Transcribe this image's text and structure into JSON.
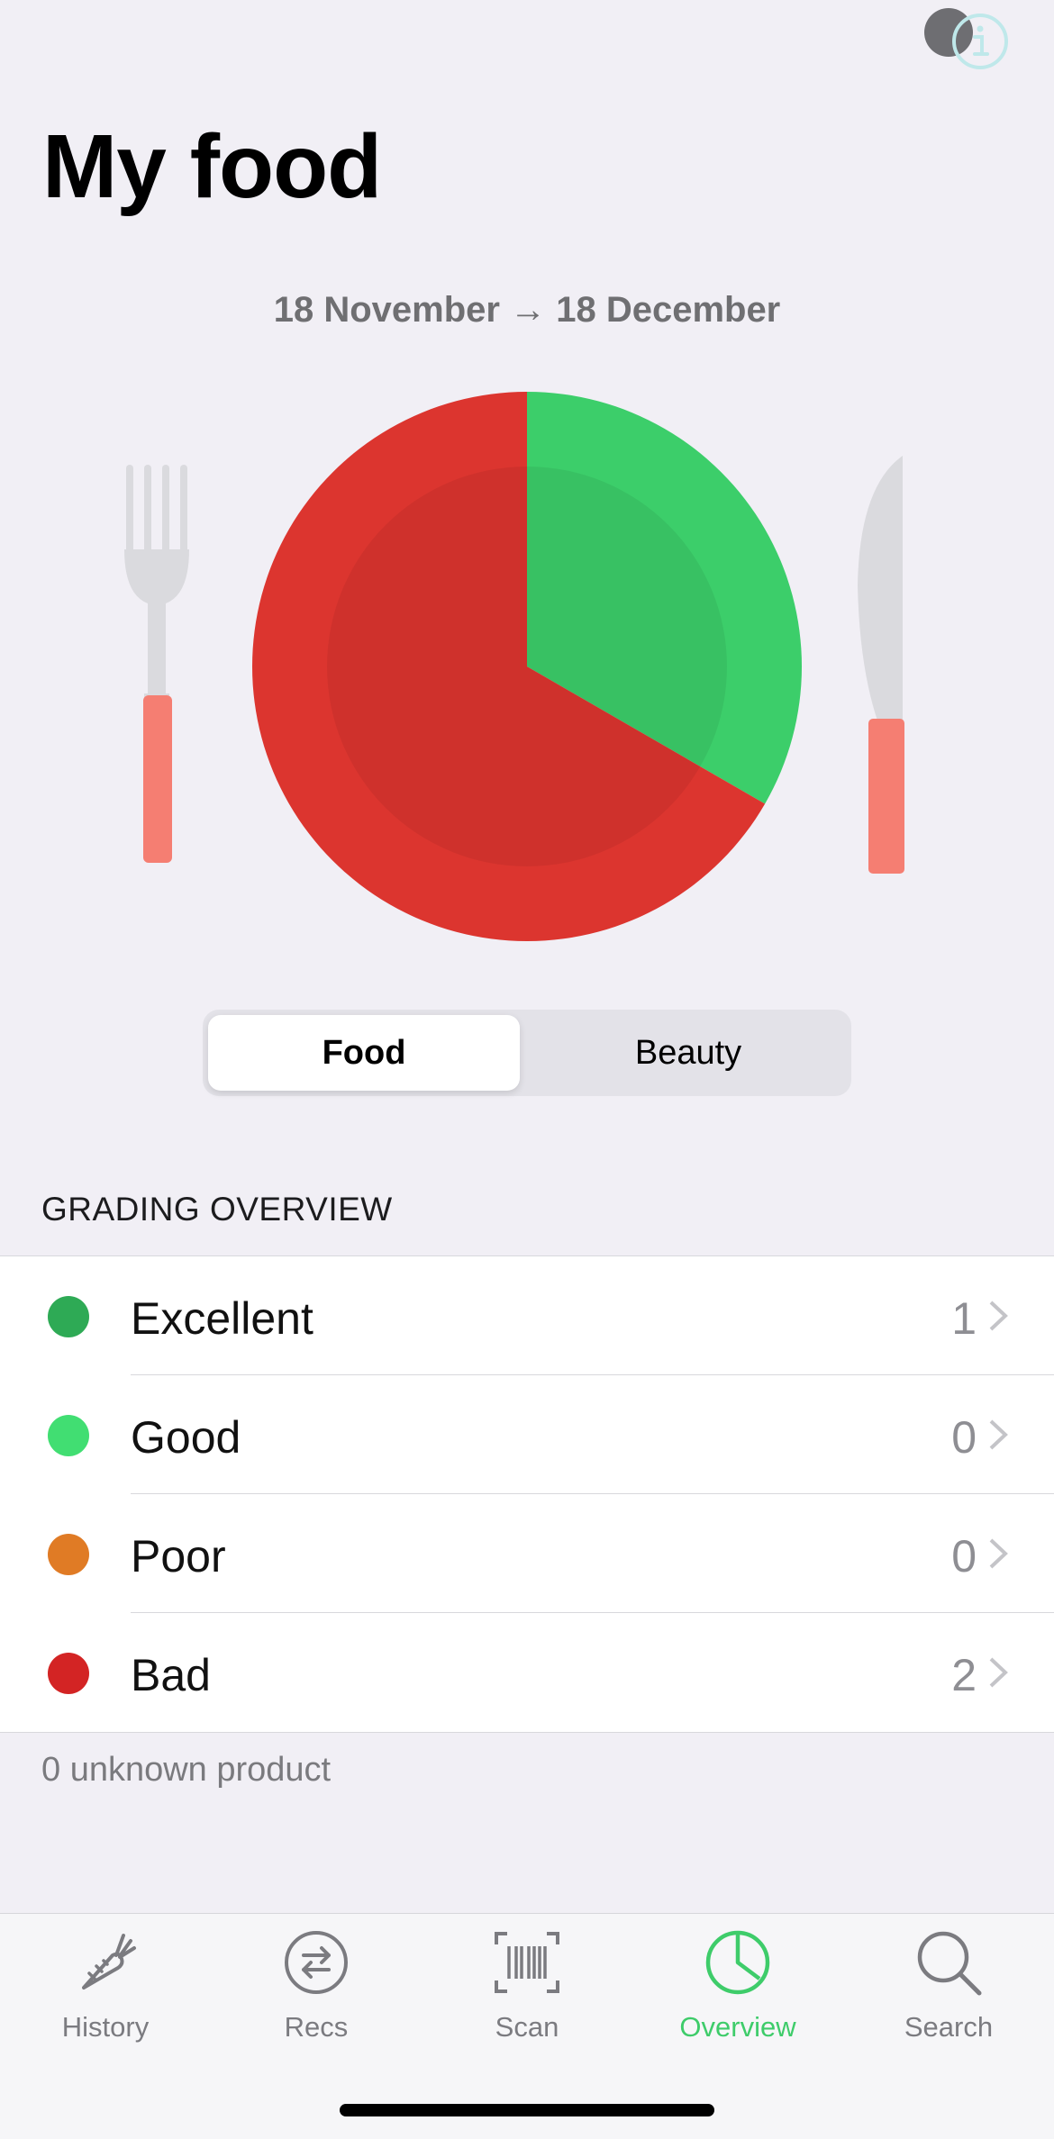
{
  "header": {
    "title": "My food",
    "date_range": "18 November → 18 December"
  },
  "colors": {
    "good_green": "#3cce6a",
    "bad_red": "#dc352f",
    "excellent": "#2eaa55",
    "good": "#41de72",
    "poor": "#e07b25",
    "bad": "#d32424",
    "active_tab": "#3ecc6a"
  },
  "chart_data": {
    "type": "pie",
    "categories": [
      "Excellent",
      "Good",
      "Poor",
      "Bad"
    ],
    "values": [
      1,
      0,
      0,
      2
    ]
  },
  "segmented": {
    "options": [
      "Food",
      "Beauty"
    ],
    "selected": "Food"
  },
  "overview": {
    "section_title": "GRADING OVERVIEW",
    "rows": [
      {
        "label": "Excellent",
        "count": "1"
      },
      {
        "label": "Good",
        "count": "0"
      },
      {
        "label": "Poor",
        "count": "0"
      },
      {
        "label": "Bad",
        "count": "2"
      }
    ],
    "footer": "0 unknown product"
  },
  "tabs": [
    {
      "label": "History",
      "icon": "carrot-icon"
    },
    {
      "label": "Recs",
      "icon": "swap-arrows-icon"
    },
    {
      "label": "Scan",
      "icon": "barcode-icon"
    },
    {
      "label": "Overview",
      "icon": "pie-chart-icon",
      "active": true
    },
    {
      "label": "Search",
      "icon": "magnifier-icon"
    }
  ]
}
